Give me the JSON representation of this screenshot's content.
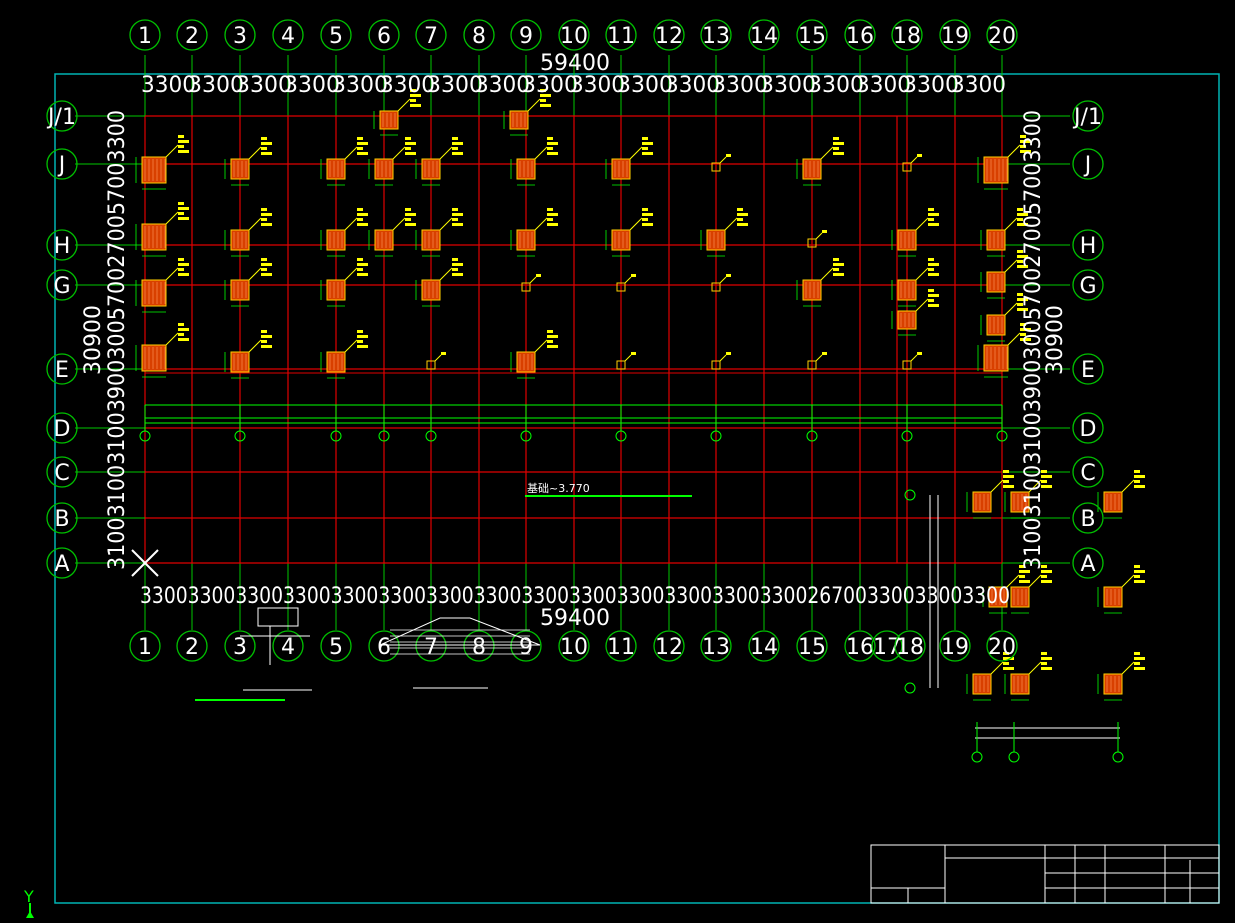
{
  "drawing": {
    "colors": {
      "background": "#000000",
      "grid_line": "#e00000",
      "axis_extension": "#00c800",
      "bubble": "#00c000",
      "text": "#ffffff",
      "frame": "#00b4b4",
      "column_fill": "#d84000",
      "column_outline": "#ffd000",
      "annotation": "#ffff00",
      "beam": "#00ff00"
    },
    "top_axes": [
      "1",
      "2",
      "3",
      "4",
      "5",
      "6",
      "7",
      "8",
      "9",
      "10",
      "11",
      "12",
      "13",
      "14",
      "15",
      "16",
      "18",
      "19",
      "20"
    ],
    "bottom_axes": [
      "1",
      "2",
      "3",
      "4",
      "5",
      "6",
      "7",
      "8",
      "9",
      "10",
      "11",
      "12",
      "13",
      "14",
      "15",
      "16",
      "17",
      "18",
      "19",
      "20"
    ],
    "rows": [
      "J/1",
      "J",
      "H",
      "G",
      "E",
      "D",
      "C",
      "B",
      "A"
    ],
    "top_total": "59400",
    "bottom_total": "59400",
    "top_spacings": [
      "3300",
      "3300",
      "3300",
      "3300",
      "3300",
      "3300",
      "3300",
      "3300",
      "3300",
      "3300",
      "3300",
      "3300",
      "3300",
      "3300",
      "3300",
      "3300",
      "3300",
      "3300"
    ],
    "bottom_spacing_text": "3300330033003300330033003300330033003300330033003300330026700330033003300",
    "left_total": "30900",
    "right_total": "30900",
    "left_vertical_dims": "31003100310039003005700270057003300",
    "right_vertical_dims": "31003100310039003005700270057003300",
    "plan_note": "基础~3.770",
    "detail_1_title": "",
    "detail_2_title": "",
    "axis_y_label": "Y"
  }
}
